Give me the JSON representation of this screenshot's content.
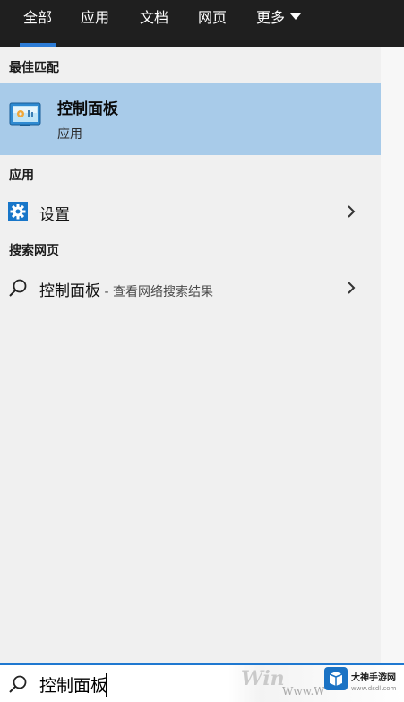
{
  "tabs": [
    {
      "label": "全部",
      "active": true
    },
    {
      "label": "应用"
    },
    {
      "label": "文档"
    },
    {
      "label": "网页"
    },
    {
      "label": "更多"
    }
  ],
  "sections": {
    "best_match": "最佳匹配",
    "apps": "应用",
    "web": "搜索网页"
  },
  "best_match_item": {
    "title": "控制面板",
    "subtitle": "应用",
    "icon": "control-panel-icon"
  },
  "app_items": [
    {
      "label": "设置",
      "icon": "gear-icon"
    }
  ],
  "web_items": [
    {
      "label": "控制面板",
      "hint": " - 查看网络搜索结果",
      "icon": "search-icon"
    }
  ],
  "search": {
    "value": "控制面板"
  },
  "watermark": {
    "win": "Win",
    "www": "Www.W",
    "site_name": "大神手游网",
    "site_url": "www.dsdl.com"
  },
  "colors": {
    "nav_bg": "#1f1f1f",
    "accent": "#2d7cd6",
    "highlight": "#a8cbe9",
    "panel_bg": "#f0f0f0"
  }
}
